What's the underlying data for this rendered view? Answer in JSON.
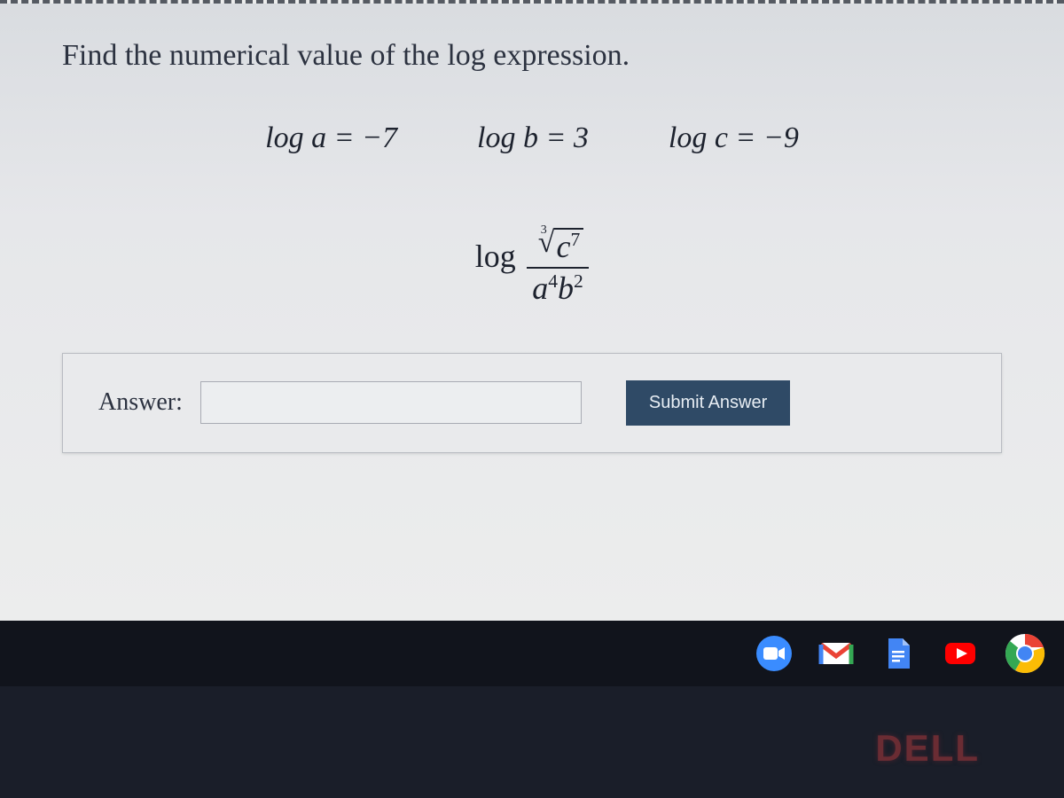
{
  "problem": {
    "prompt": "Find the numerical value of the log expression.",
    "givens": {
      "a": "log a = −7",
      "b": "log b = 3",
      "c": "log c = −9"
    },
    "expression": {
      "log_label": "log",
      "root_index": "3",
      "numerator_base": "c",
      "numerator_exp": "7",
      "denominator_a_base": "a",
      "denominator_a_exp": "4",
      "denominator_b_base": "b",
      "denominator_b_exp": "2"
    }
  },
  "answer": {
    "label": "Answer:",
    "value": "",
    "submit_label": "Submit Answer"
  },
  "taskbar": {
    "icons": [
      "zoom-icon",
      "gmail-icon",
      "docs-icon",
      "youtube-icon",
      "chrome-icon"
    ]
  },
  "monitor": {
    "brand": "DELL"
  }
}
